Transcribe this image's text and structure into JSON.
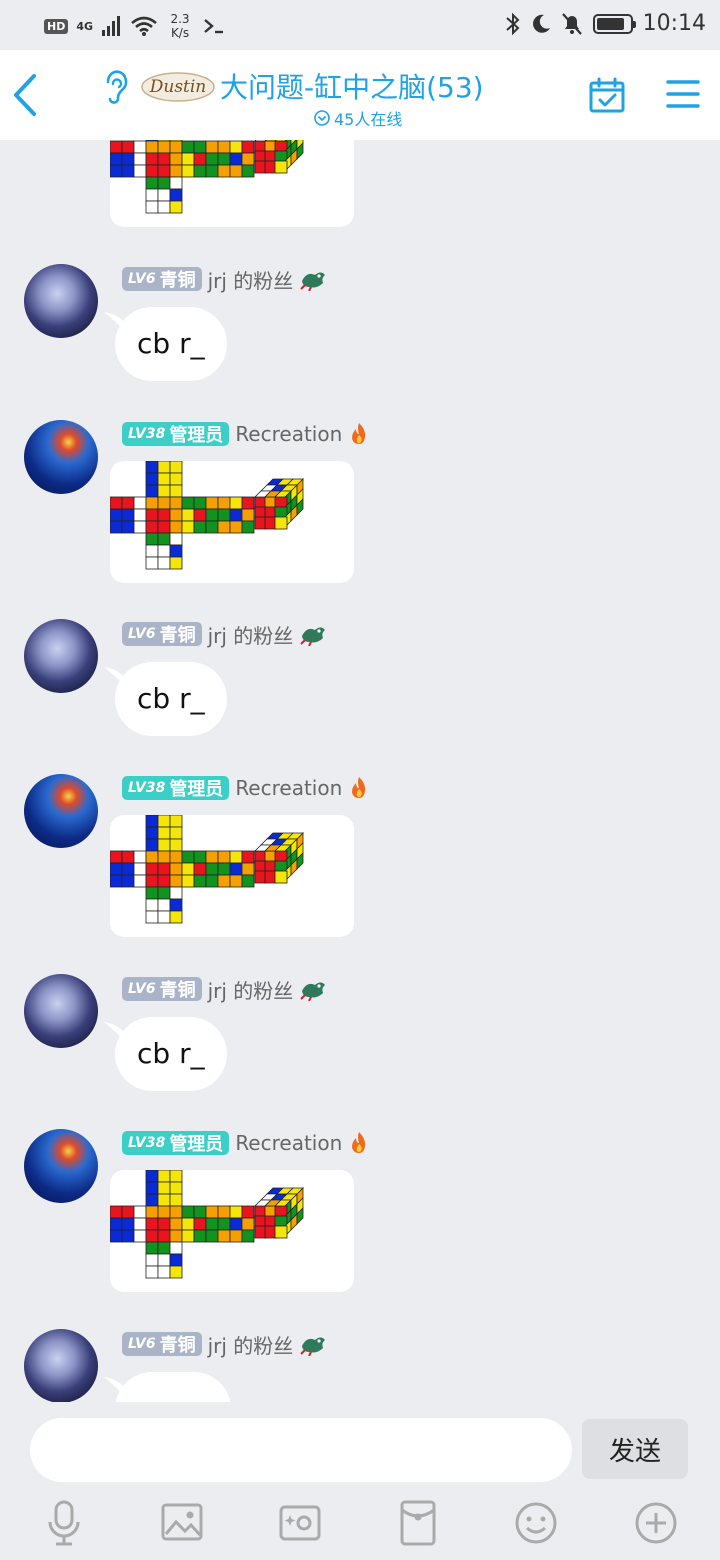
{
  "status": {
    "hd": "HD",
    "network": "4G",
    "speed_value": "2.3",
    "speed_unit": "K/s",
    "time": "10:14",
    "battery_level": 0.85
  },
  "header": {
    "logo_text": "Dustin",
    "title": "大问题-缸中之脑(53)",
    "online": "45人在线"
  },
  "messages": [
    {
      "type": "image",
      "sender": "Recreation",
      "partial": true
    },
    {
      "type": "text",
      "level": "LV6",
      "title": "青铜",
      "sender": "jrj 的粉丝",
      "text": "cb r_"
    },
    {
      "type": "image",
      "level": "LV38",
      "title": "管理员",
      "sender": "Recreation"
    },
    {
      "type": "text",
      "level": "LV6",
      "title": "青铜",
      "sender": "jrj 的粉丝",
      "text": "cb r_"
    },
    {
      "type": "image",
      "level": "LV38",
      "title": "管理员",
      "sender": "Recreation"
    },
    {
      "type": "text",
      "level": "LV6",
      "title": "青铜",
      "sender": "jrj 的粉丝",
      "text": "cb r_"
    },
    {
      "type": "image",
      "level": "LV38",
      "title": "管理员",
      "sender": "Recreation"
    },
    {
      "type": "text",
      "level": "LV6",
      "title": "青铜",
      "sender": "jrj 的粉丝",
      "text": "",
      "partial": true
    }
  ],
  "composer": {
    "input_value": "",
    "send_label": "发送",
    "tools": [
      "microphone-icon",
      "photo-icon",
      "camera-icon",
      "red-packet-icon",
      "emoji-icon",
      "plus-icon"
    ]
  },
  "colors": {
    "accent": "#1fa2e6",
    "background": "#ebedf0",
    "bronze_badge": "#aab4c8",
    "admin_badge": "#3ccfc8"
  }
}
